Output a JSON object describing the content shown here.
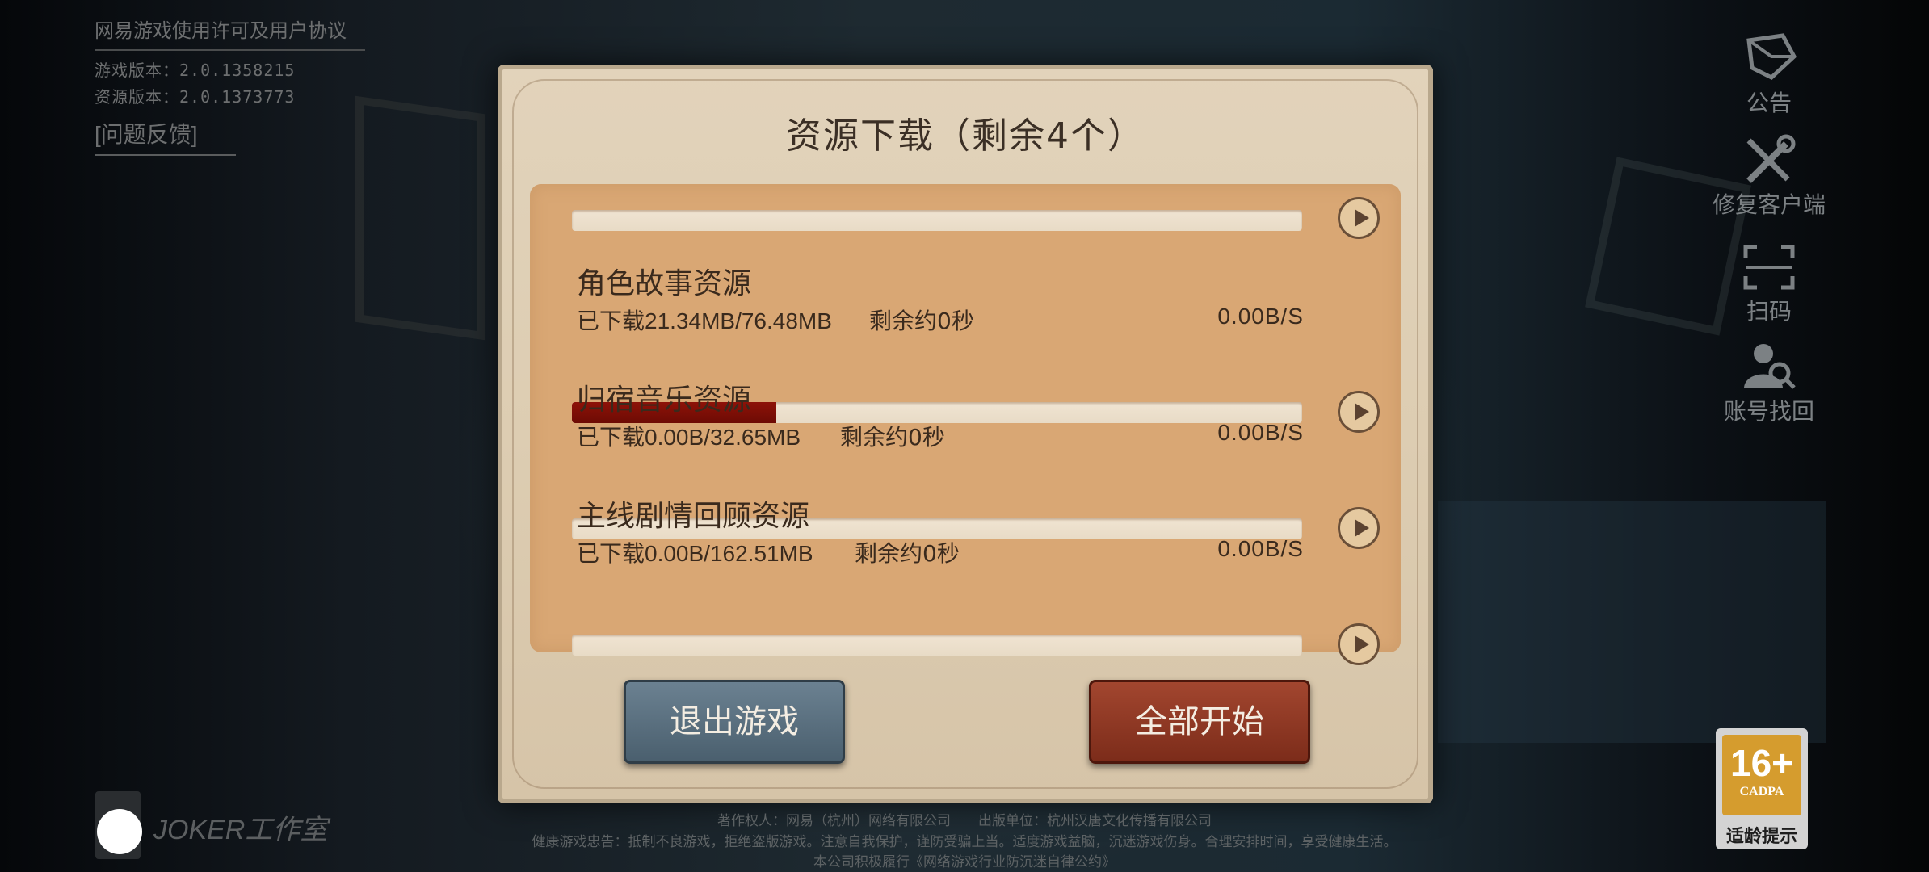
{
  "top_left": {
    "agreement": "网易游戏使用许可及用户协议",
    "game_version": "游戏版本：2.0.1358215",
    "resource_version": "资源版本：2.0.1373773",
    "feedback": "[问题反馈]"
  },
  "side_menu": [
    {
      "label": "公告",
      "icon": "announcement-icon"
    },
    {
      "label": "修复客户端",
      "icon": "repair-tools-icon"
    },
    {
      "label": "扫码",
      "icon": "scan-icon"
    },
    {
      "label": "账号找回",
      "icon": "account-recovery-icon"
    }
  ],
  "dialog": {
    "title": "资源下载（剩余4个）",
    "items": [
      {
        "name": "角色故事资源",
        "downloaded": "已下载21.34MB/76.48MB",
        "remaining": "剩余约0秒",
        "speed": "0.00B/S",
        "progress": 0.28
      },
      {
        "name": "归宿音乐资源",
        "downloaded": "已下载0.00B/32.65MB",
        "remaining": "剩余约0秒",
        "speed": "0.00B/S",
        "progress": 0
      },
      {
        "name": "主线剧情回顾资源",
        "downloaded": "已下载0.00B/162.51MB",
        "remaining": "剩余约0秒",
        "speed": "0.00B/S",
        "progress": 0
      }
    ],
    "exit_button": "退出游戏",
    "start_all_button": "全部开始"
  },
  "footer": {
    "line1": "著作权人：网易（杭州）网络有限公司　　出版单位：杭州汉唐文化传播有限公司",
    "line2": "健康游戏忠告：抵制不良游戏，拒绝盗版游戏。注意自我保护，谨防受骗上当。适度游戏益脑，沉迷游戏伤身。合理安排时间，享受健康生活。",
    "line3": "本公司积极履行《网络游戏行业防沉迷自律公约》"
  },
  "studio_logo": "JOKER工作室",
  "age_rating": {
    "rating": "16+",
    "org": "CADPA",
    "tip": "适龄提示"
  }
}
